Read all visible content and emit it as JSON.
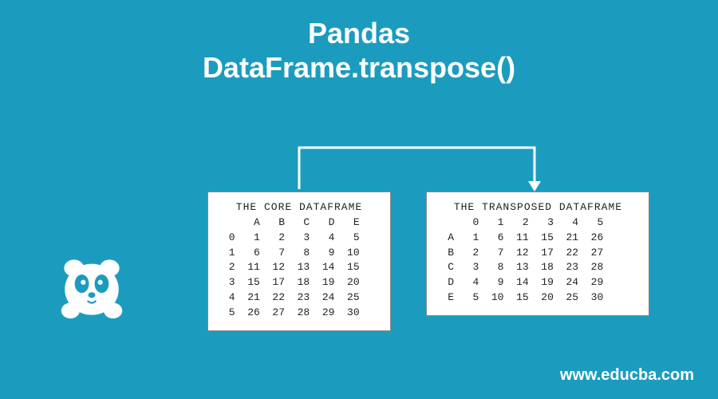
{
  "title": {
    "line1": "Pandas",
    "line2": "DataFrame.transpose()"
  },
  "logo": {
    "semantic": "panda-icon"
  },
  "chart_data": [
    {
      "type": "table",
      "title": "THE CORE DATAFRAME",
      "columns": [
        "A",
        "B",
        "C",
        "D",
        "E"
      ],
      "index": [
        "0",
        "1",
        "2",
        "3",
        "4",
        "5"
      ],
      "rows": [
        [
          1,
          2,
          3,
          4,
          5
        ],
        [
          6,
          7,
          8,
          9,
          10
        ],
        [
          11,
          12,
          13,
          14,
          15
        ],
        [
          15,
          17,
          18,
          19,
          20
        ],
        [
          21,
          22,
          23,
          24,
          25
        ],
        [
          26,
          27,
          28,
          29,
          30
        ]
      ]
    },
    {
      "type": "table",
      "title": "THE TRANSPOSED DATAFRAME",
      "columns": [
        "0",
        "1",
        "2",
        "3",
        "4",
        "5"
      ],
      "index": [
        "A",
        "B",
        "C",
        "D",
        "E"
      ],
      "rows": [
        [
          1,
          6,
          11,
          15,
          21,
          26
        ],
        [
          2,
          7,
          12,
          17,
          22,
          27
        ],
        [
          3,
          8,
          13,
          18,
          23,
          28
        ],
        [
          4,
          9,
          14,
          19,
          24,
          29
        ],
        [
          5,
          10,
          15,
          20,
          25,
          30
        ]
      ]
    }
  ],
  "footer": "www.educba.com"
}
